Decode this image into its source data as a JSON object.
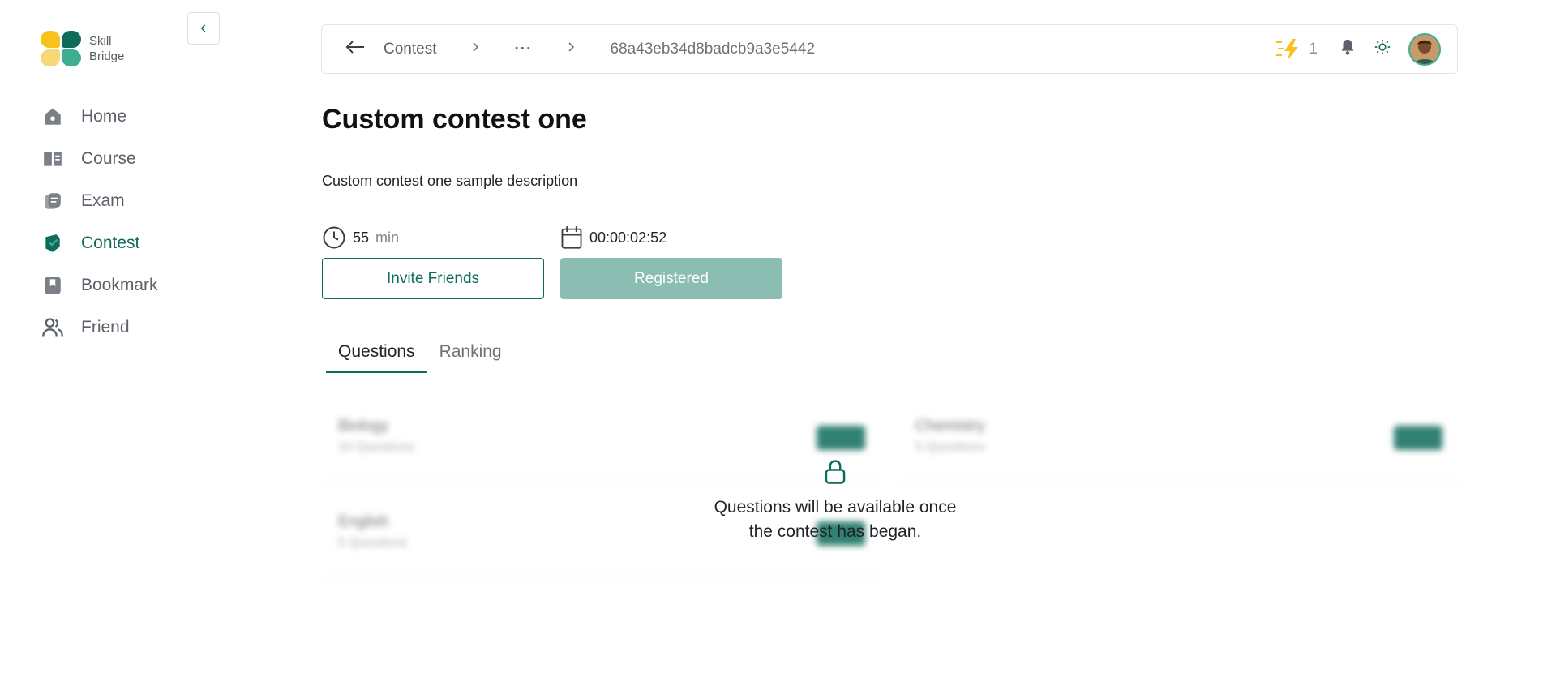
{
  "brand": {
    "line1": "Skill",
    "line2": "Bridge"
  },
  "sidebar": {
    "items": [
      {
        "label": "Home",
        "icon": "home-icon",
        "active": false
      },
      {
        "label": "Course",
        "icon": "book-icon",
        "active": false
      },
      {
        "label": "Exam",
        "icon": "exam-icon",
        "active": false
      },
      {
        "label": "Contest",
        "icon": "contest-icon",
        "active": true
      },
      {
        "label": "Bookmark",
        "icon": "bookmark-icon",
        "active": false
      },
      {
        "label": "Friend",
        "icon": "friends-icon",
        "active": false
      }
    ]
  },
  "breadcrumb": {
    "back_icon": "arrow-left-icon",
    "root": "Contest",
    "ellipsis": "···",
    "current": "68a43eb34d8badcb9a3e5442"
  },
  "header": {
    "streak_count": "1"
  },
  "contest": {
    "title": "Custom contest one",
    "description": "Custom contest one sample description",
    "duration_value": "55",
    "duration_unit": "min",
    "countdown": "00:00:02:52",
    "invite_label": "Invite Friends",
    "registered_label": "Registered"
  },
  "tabs": [
    {
      "label": "Questions",
      "active": true
    },
    {
      "label": "Ranking",
      "active": false
    }
  ],
  "questions": [
    {
      "title": "Biology",
      "count": "10 Questions"
    },
    {
      "title": "Chemistry",
      "count": "5 Questions"
    },
    {
      "title": "English",
      "count": "5 Questions"
    }
  ],
  "locked_message": "Questions will be available once the contest has began.",
  "colors": {
    "primary": "#0f6b5a",
    "accent": "#3cae92",
    "yellow": "#f6c21b",
    "registered_bg": "#8cbdb3"
  }
}
